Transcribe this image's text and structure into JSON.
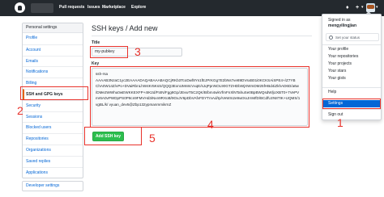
{
  "header": {
    "nav": [
      "Pull requests",
      "Issues",
      "Marketplace",
      "Explore"
    ],
    "icons": [
      "github-logo",
      "bell-icon",
      "plus-icon",
      "avatar"
    ]
  },
  "sidebar": {
    "title": "Personal settings",
    "items": [
      "Profile",
      "Account",
      "Emails",
      "Notifications",
      "Billing",
      "SSH and GPG keys",
      "Security",
      "Sessions",
      "Blocked users",
      "Repositories",
      "Organizations",
      "Saved replies",
      "Applications"
    ],
    "bottom": "Developer settings"
  },
  "main": {
    "heading": "SSH keys / Add new",
    "title_label": "Title",
    "title_value": "my-pubkey",
    "key_label": "Key",
    "key_lines": [
      "ssh-rsa",
      "AAAAB3NzaC1yc2EAAAADAQABAAABAQCjRKb3TcoDwf8Ys1fEJPrKGg7E2bNs7ve89DVsxB01i0KCKSAiSPE4+/Z7YB",
      "ChA0W14Z/vPo+DVaiRbnLhW4Kr5KsS/QQQ3ExnUMn8cVxqE/sJqPpnNOL90GTZHDbWjXWmDM25fHBd4iZkhAD6D/a6w",
      "/DMe2WWhu0wEWKKEXFP+4IK2d/Ft4N/Fgg8Gp/JEvwT5C2QK/B/bm4wkVfmFnXlNTahuSe0BpBWQsdWljUXBT0+7VePV",
      "mr6A0vPWDpPS0P8cn9FMVHd3iNxn9RXoB/9OxJV6pDbVAfvFDYTmAd/Ip/VeWm2e9wtXxJrnMfD/BCdfUzN8TIK+UQMS/1",
      "vgBL/k/ vyuan_dev5@Zbp132ypmanmmikrnZ"
    ],
    "add_button": "Add SSH key"
  },
  "annotations": [
    "1",
    "2",
    "3",
    "4",
    "5"
  ],
  "dropdown": {
    "signed_in_as": "Signed in as",
    "username": "mengyilingjian",
    "status": "Set your status",
    "items_group1": [
      "Your profile",
      "Your repositories",
      "Your projects",
      "Your stars",
      "Your gists"
    ],
    "items_group2": [
      "Help",
      "Settings"
    ],
    "sign_out": "Sign out"
  },
  "colors": {
    "header_bg": "#24292e",
    "link": "#0366d6",
    "button_green": "#2cbe4e",
    "annotation_red": "#e8322b",
    "active_bg": "#0366d6",
    "selected_border": "#e36209"
  }
}
